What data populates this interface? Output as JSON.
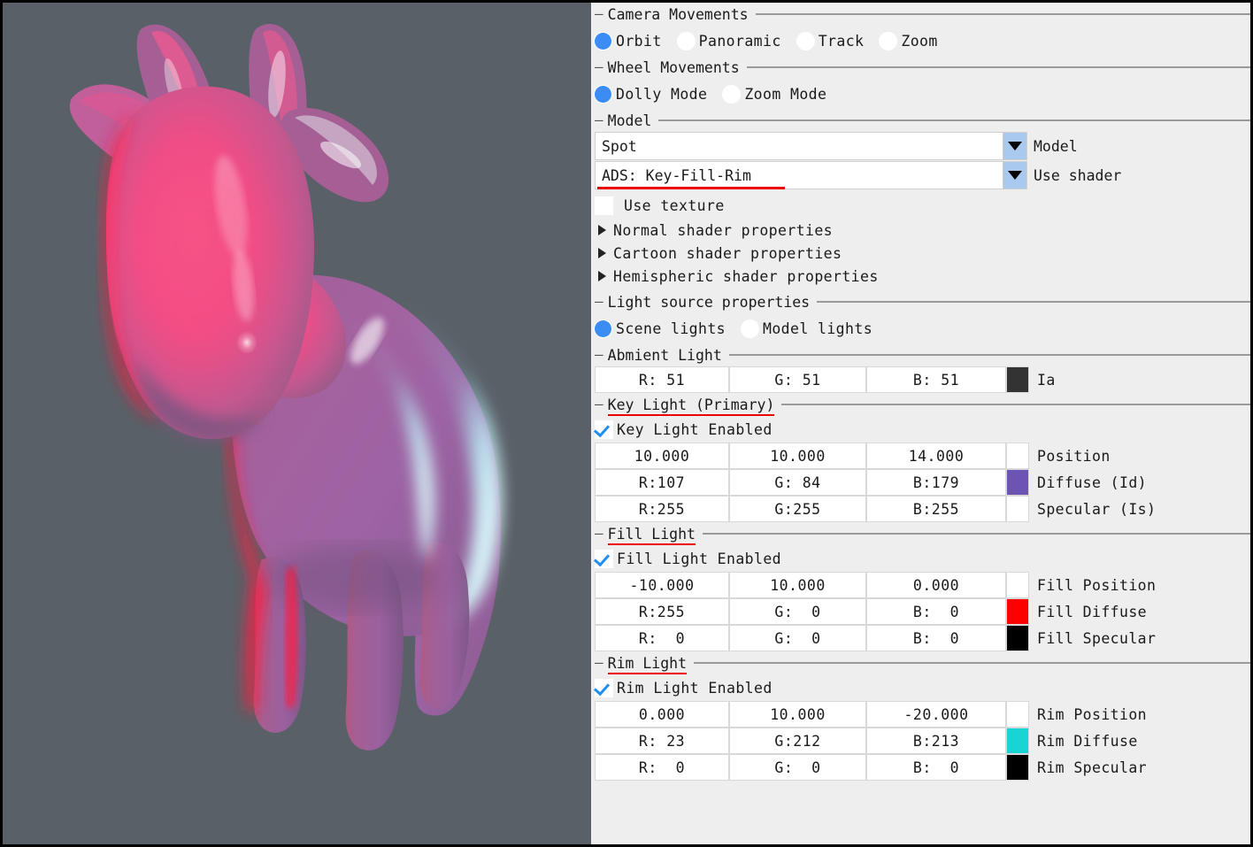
{
  "viewport": {
    "name": "3d-render-viewport",
    "background_color": "#5a6067",
    "model_name": "Spot",
    "description": "Shaded 3D cow model lit with magenta key light, red fill light and cyan rim light"
  },
  "camera_movements": {
    "title": "Camera Movements",
    "options": [
      {
        "label": "Orbit",
        "selected": true
      },
      {
        "label": "Panoramic",
        "selected": false
      },
      {
        "label": "Track",
        "selected": false
      },
      {
        "label": "Zoom",
        "selected": false
      }
    ]
  },
  "wheel_movements": {
    "title": "Wheel Movements",
    "options": [
      {
        "label": "Dolly Mode",
        "selected": true
      },
      {
        "label": "Zoom Mode",
        "selected": false
      }
    ]
  },
  "model": {
    "title": "Model",
    "model_select": {
      "value": "Spot",
      "label": "Model"
    },
    "shader_select": {
      "value": "ADS: Key-Fill-Rim",
      "label": "Use shader",
      "underlined": true
    },
    "use_texture": {
      "label": "Use texture",
      "checked": false
    },
    "tree_items": [
      {
        "label": "Normal shader properties",
        "expanded": false
      },
      {
        "label": "Cartoon shader properties",
        "expanded": false
      },
      {
        "label": "Hemispheric shader properties",
        "expanded": false
      }
    ]
  },
  "light_source_properties": {
    "title": "Light source properties",
    "options": [
      {
        "label": "Scene lights",
        "selected": true
      },
      {
        "label": "Model lights",
        "selected": false
      }
    ]
  },
  "ambient_light": {
    "title": "Abmient Light",
    "row": {
      "r": "R: 51",
      "g": "G: 51",
      "b": "B: 51",
      "swatch": "#333333",
      "label": "Ia"
    }
  },
  "key_light": {
    "title": "Key Light (Primary)",
    "title_underlined": true,
    "enabled": {
      "label": "Key Light Enabled",
      "checked": true
    },
    "position": {
      "x": "10.000",
      "y": "10.000",
      "z": "14.000",
      "label": "Position",
      "swatch": null
    },
    "diffuse": {
      "r": "R:107",
      "g": "G: 84",
      "b": "B:179",
      "swatch": "#6b54b3",
      "label": "Diffuse (Id)"
    },
    "specular": {
      "r": "R:255",
      "g": "G:255",
      "b": "B:255",
      "swatch": "#ffffff",
      "label": "Specular (Is)"
    }
  },
  "fill_light": {
    "title": "Fill Light",
    "title_underlined": true,
    "enabled": {
      "label": "Fill Light Enabled",
      "checked": true
    },
    "position": {
      "x": "-10.000",
      "y": "10.000",
      "z": "0.000",
      "label": "Fill Position",
      "swatch": null
    },
    "diffuse": {
      "r": "R:255",
      "g": "G:  0",
      "b": "B:  0",
      "swatch": "#ff0000",
      "label": "Fill Diffuse"
    },
    "specular": {
      "r": "R:  0",
      "g": "G:  0",
      "b": "B:  0",
      "swatch": "#000000",
      "label": "Fill Specular"
    }
  },
  "rim_light": {
    "title": "Rim Light",
    "title_underlined": true,
    "enabled": {
      "label": "Rim Light Enabled",
      "checked": true
    },
    "position": {
      "x": "0.000",
      "y": "10.000",
      "z": "-20.000",
      "label": "Rim Position",
      "swatch": null
    },
    "diffuse": {
      "r": "R: 23",
      "g": "G:212",
      "b": "B:213",
      "swatch": "#17d4d5",
      "label": "Rim Diffuse"
    },
    "specular": {
      "r": "R:  0",
      "g": "G:  0",
      "b": "B:  0",
      "swatch": "#000000",
      "label": "Rim Specular"
    }
  },
  "colors": {
    "panel_bg": "#eeeeee",
    "field_bg": "#ffffff",
    "radio_on": "#3b8cf5",
    "dropdown_btn": "#a9c9ee",
    "underline_accent": "#ef0000",
    "separator": "#9a9a9a"
  }
}
